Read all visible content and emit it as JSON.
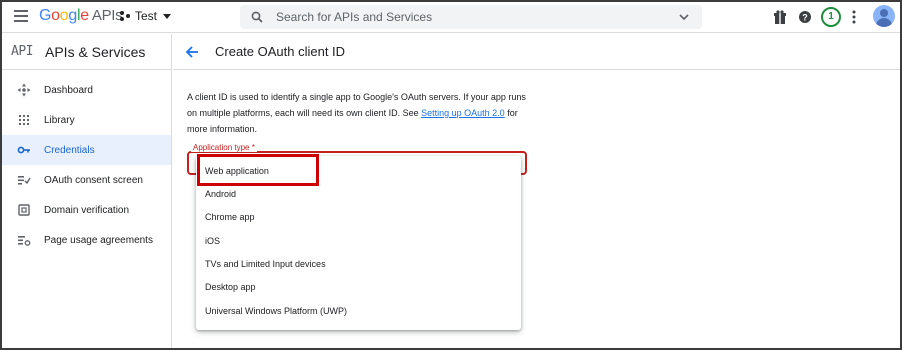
{
  "topbar": {
    "logo_parts": [
      "G",
      "o",
      "o",
      "g",
      "l",
      "e"
    ],
    "logo_suffix": "APIs",
    "project": "Test",
    "search_placeholder": "Search for APIs and Services",
    "notification_count": "1",
    "icons": [
      "menu-icon",
      "gift-icon",
      "help-icon",
      "more-vert-icon",
      "account-icon"
    ]
  },
  "sidebar": {
    "api_mark": "API",
    "title": "APIs & Services",
    "items": [
      {
        "label": "Dashboard",
        "icon": "dashboard-icon"
      },
      {
        "label": "Library",
        "icon": "library-icon"
      },
      {
        "label": "Credentials",
        "icon": "key-icon",
        "active": true
      },
      {
        "label": "OAuth consent screen",
        "icon": "consent-icon"
      },
      {
        "label": "Domain verification",
        "icon": "domain-icon"
      },
      {
        "label": "Page usage agreements",
        "icon": "settings-list-icon"
      }
    ]
  },
  "main": {
    "title": "Create OAuth client ID",
    "description_before": "A client ID is used to identify a single app to Google's OAuth servers. If your app runs on multiple platforms, each will need its own client ID. See ",
    "description_link": "Setting up OAuth 2.0",
    "description_after": " for more information.",
    "field_label": "Application type *",
    "options": [
      "Web application",
      "Android",
      "Chrome app",
      "iOS",
      "TVs and Limited Input devices",
      "Desktop app",
      "Universal Windows Platform (UWP)"
    ]
  },
  "colors": {
    "accent": "#1a73e8",
    "error": "#c5221f",
    "active_bg": "#e8f0fe",
    "highlight_box": "#cc0000"
  }
}
